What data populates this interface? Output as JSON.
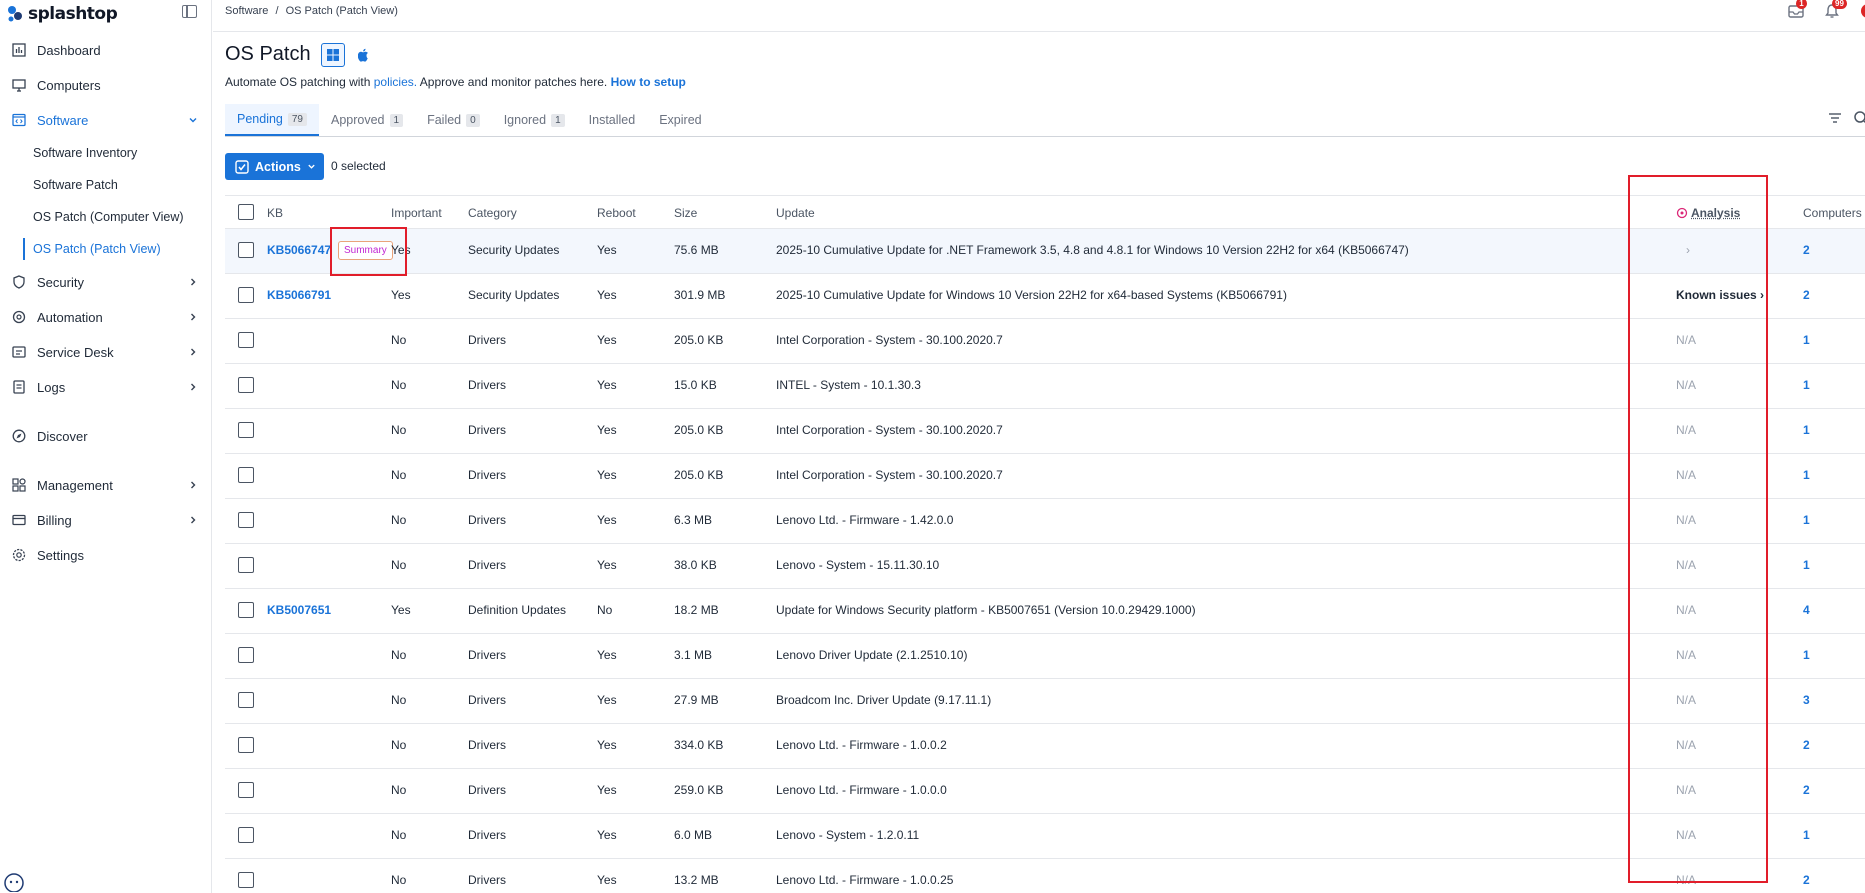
{
  "brand": {
    "name": "splashtop"
  },
  "sidebar": {
    "items": [
      {
        "label": "Dashboard"
      },
      {
        "label": "Computers"
      },
      {
        "label": "Software"
      },
      {
        "label": "Security"
      },
      {
        "label": "Automation"
      },
      {
        "label": "Service Desk"
      },
      {
        "label": "Logs"
      },
      {
        "label": "Discover"
      },
      {
        "label": "Management"
      },
      {
        "label": "Billing"
      },
      {
        "label": "Settings"
      }
    ],
    "software_sub": [
      {
        "label": "Software Inventory"
      },
      {
        "label": "Software Patch"
      },
      {
        "label": "OS Patch (Computer View)"
      },
      {
        "label": "OS Patch (Patch View)"
      }
    ]
  },
  "breadcrumb": {
    "root": "Software",
    "sep": "/",
    "current": "OS Patch (Patch View)"
  },
  "header": {
    "inbox_badge": "1",
    "notif_badge": "99"
  },
  "page": {
    "title": "OS Patch",
    "subtitle_pre": "Automate OS patching with ",
    "subtitle_link": "policies.",
    "subtitle_mid": " Approve and monitor patches here. ",
    "subtitle_link2": "How to setup"
  },
  "tabs": [
    {
      "label": "Pending",
      "count": "79"
    },
    {
      "label": "Approved",
      "count": "1"
    },
    {
      "label": "Failed",
      "count": "0"
    },
    {
      "label": "Ignored",
      "count": "1"
    },
    {
      "label": "Installed",
      "count": ""
    },
    {
      "label": "Expired",
      "count": ""
    }
  ],
  "toolbar": {
    "actions_label": "Actions",
    "selected_text": "0 selected"
  },
  "table": {
    "headers": {
      "kb": "KB",
      "important": "Important",
      "category": "Category",
      "reboot": "Reboot",
      "size": "Size",
      "update": "Update",
      "analysis": "Analysis",
      "computers": "Computers"
    },
    "summary_tag": "Summary",
    "rows": [
      {
        "kb": "KB5066747",
        "important": "Yes",
        "category": "Security Updates",
        "reboot": "Yes",
        "size": "75.6 MB",
        "update": "2025-10 Cumulative Update for .NET Framework 3.5, 4.8 and 4.8.1 for Windows 10 Version 22H2 for x64 (KB5066747)",
        "analysis": "›",
        "computers": "2"
      },
      {
        "kb": "KB5066791",
        "important": "Yes",
        "category": "Security Updates",
        "reboot": "Yes",
        "size": "301.9 MB",
        "update": "2025-10 Cumulative Update for Windows 10 Version 22H2 for x64-based Systems (KB5066791)",
        "analysis": "Known issues ›",
        "computers": "2"
      },
      {
        "kb": "",
        "important": "No",
        "category": "Drivers",
        "reboot": "Yes",
        "size": "205.0 KB",
        "update": "Intel Corporation - System - 30.100.2020.7",
        "analysis": "N/A",
        "computers": "1"
      },
      {
        "kb": "",
        "important": "No",
        "category": "Drivers",
        "reboot": "Yes",
        "size": "15.0 KB",
        "update": "INTEL - System - 10.1.30.3",
        "analysis": "N/A",
        "computers": "1"
      },
      {
        "kb": "",
        "important": "No",
        "category": "Drivers",
        "reboot": "Yes",
        "size": "205.0 KB",
        "update": "Intel Corporation - System - 30.100.2020.7",
        "analysis": "N/A",
        "computers": "1"
      },
      {
        "kb": "",
        "important": "No",
        "category": "Drivers",
        "reboot": "Yes",
        "size": "205.0 KB",
        "update": "Intel Corporation - System - 30.100.2020.7",
        "analysis": "N/A",
        "computers": "1"
      },
      {
        "kb": "",
        "important": "No",
        "category": "Drivers",
        "reboot": "Yes",
        "size": "6.3 MB",
        "update": "Lenovo Ltd. - Firmware - 1.42.0.0",
        "analysis": "N/A",
        "computers": "1"
      },
      {
        "kb": "",
        "important": "No",
        "category": "Drivers",
        "reboot": "Yes",
        "size": "38.0 KB",
        "update": "Lenovo - System - 15.11.30.10",
        "analysis": "N/A",
        "computers": "1"
      },
      {
        "kb": "KB5007651",
        "important": "Yes",
        "category": "Definition Updates",
        "reboot": "No",
        "size": "18.2 MB",
        "update": "Update for Windows Security platform - KB5007651 (Version 10.0.29429.1000)",
        "analysis": "N/A",
        "computers": "4"
      },
      {
        "kb": "",
        "important": "No",
        "category": "Drivers",
        "reboot": "Yes",
        "size": "3.1 MB",
        "update": "Lenovo Driver Update (2.1.2510.10)",
        "analysis": "N/A",
        "computers": "1"
      },
      {
        "kb": "",
        "important": "No",
        "category": "Drivers",
        "reboot": "Yes",
        "size": "27.9 MB",
        "update": "Broadcom Inc. Driver Update (9.17.11.1)",
        "analysis": "N/A",
        "computers": "3"
      },
      {
        "kb": "",
        "important": "No",
        "category": "Drivers",
        "reboot": "Yes",
        "size": "334.0 KB",
        "update": "Lenovo Ltd. - Firmware - 1.0.0.2",
        "analysis": "N/A",
        "computers": "2"
      },
      {
        "kb": "",
        "important": "No",
        "category": "Drivers",
        "reboot": "Yes",
        "size": "259.0 KB",
        "update": "Lenovo Ltd. - Firmware - 1.0.0.0",
        "analysis": "N/A",
        "computers": "2"
      },
      {
        "kb": "",
        "important": "No",
        "category": "Drivers",
        "reboot": "Yes",
        "size": "6.0 MB",
        "update": "Lenovo - System - 1.2.0.11",
        "analysis": "N/A",
        "computers": "1"
      },
      {
        "kb": "",
        "important": "No",
        "category": "Drivers",
        "reboot": "Yes",
        "size": "13.2 MB",
        "update": "Lenovo Ltd. - Firmware - 1.0.0.25",
        "analysis": "N/A",
        "computers": "2"
      }
    ]
  },
  "colors": {
    "accent": "#1a73d8",
    "highlight": "#e11d2a",
    "summary_text": "#c026d3"
  }
}
